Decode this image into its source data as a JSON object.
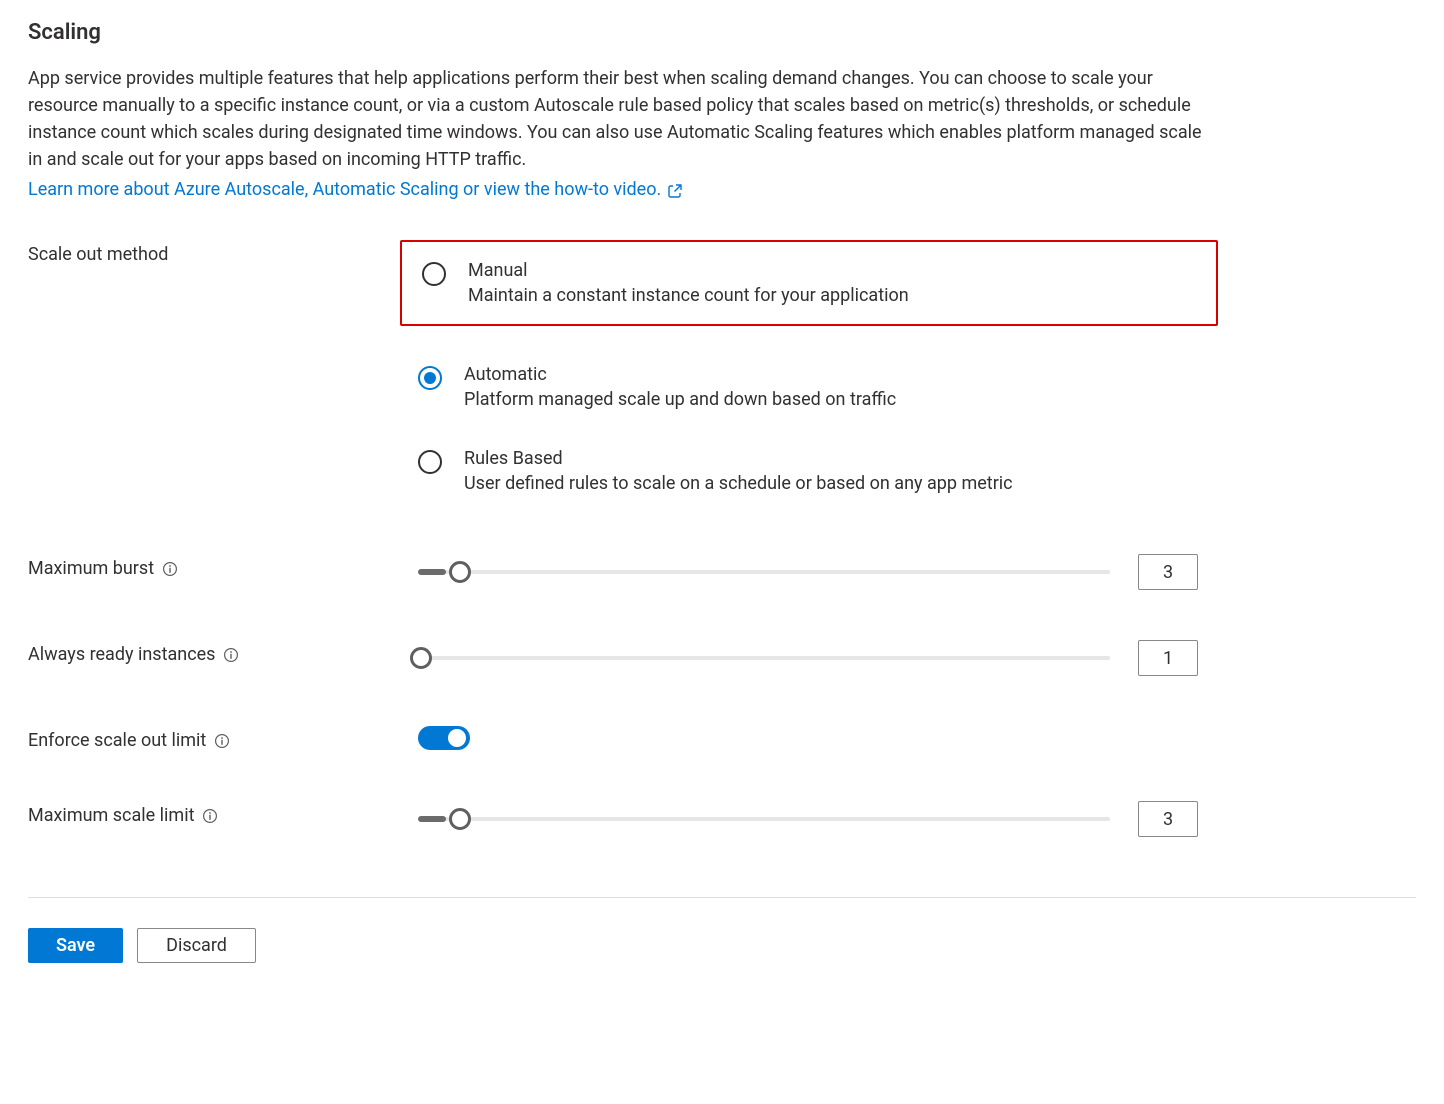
{
  "section_title": "Scaling",
  "description": "App service provides multiple features that help applications perform their best when scaling demand changes. You can choose to scale your resource manually to a specific instance count, or via a custom Autoscale rule based policy that scales based on metric(s) thresholds, or schedule instance count which scales during designated time windows. You can also use Automatic Scaling features which enables platform managed scale in and scale out for your apps based on incoming HTTP traffic.",
  "learn_more_link": "Learn more about Azure Autoscale, Automatic Scaling or view the how-to video.",
  "scale_out_method": {
    "label": "Scale out method",
    "selected": "automatic",
    "options": {
      "manual": {
        "title": "Manual",
        "desc": "Maintain a constant instance count for your application"
      },
      "automatic": {
        "title": "Automatic",
        "desc": "Platform managed scale up and down based on traffic"
      },
      "rules": {
        "title": "Rules Based",
        "desc": "User defined rules to scale on a schedule or based on any app metric"
      }
    }
  },
  "maximum_burst": {
    "label": "Maximum burst",
    "value": "3",
    "thumb_pct": 6,
    "fill_pct": 4
  },
  "always_ready": {
    "label": "Always ready instances",
    "value": "1",
    "thumb_pct": 0.5,
    "fill_pct": 0
  },
  "enforce_limit": {
    "label": "Enforce scale out limit",
    "on": true
  },
  "max_scale_limit": {
    "label": "Maximum scale limit",
    "value": "3",
    "thumb_pct": 6,
    "fill_pct": 4
  },
  "footer": {
    "save": "Save",
    "discard": "Discard"
  }
}
